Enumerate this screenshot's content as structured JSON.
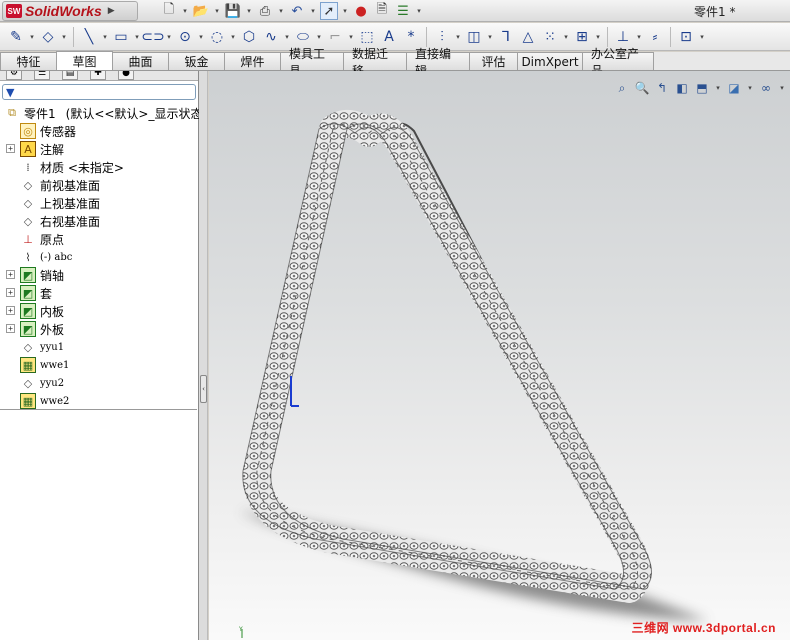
{
  "app": {
    "name": "SolidWorks",
    "logo_mark": "SW",
    "document_title": "零件1 *"
  },
  "tabs": [
    "特征",
    "草图",
    "曲面",
    "钣金",
    "焊件",
    "模具工具",
    "数据迁移",
    "直接编辑",
    "评估",
    "DimXpert",
    "办公室产品"
  ],
  "active_tab": "草图",
  "feature_tree": {
    "filter_icon": "filter-icon",
    "root": {
      "label": "零件1",
      "state": "(默认<<默认>_显示状态"
    },
    "items": [
      {
        "label": "传感器",
        "icon": "sensor-icon",
        "expand": false
      },
      {
        "label": "注解",
        "icon": "annotation-icon",
        "expand": true
      },
      {
        "label": "材质 <未指定>",
        "icon": "material-icon",
        "expand": false
      },
      {
        "label": "前视基准面",
        "icon": "plane-icon",
        "expand": false
      },
      {
        "label": "上视基准面",
        "icon": "plane-icon",
        "expand": false
      },
      {
        "label": "右视基准面",
        "icon": "plane-icon",
        "expand": false
      },
      {
        "label": "原点",
        "icon": "origin-icon",
        "expand": false
      },
      {
        "label": "(-) abc",
        "icon": "sketch-icon",
        "expand": false,
        "small": true
      },
      {
        "label": "销轴",
        "icon": "body-icon",
        "expand": true
      },
      {
        "label": "套",
        "icon": "body-icon",
        "expand": true
      },
      {
        "label": "内板",
        "icon": "body-icon",
        "expand": true
      },
      {
        "label": "外板",
        "icon": "body-icon",
        "expand": true
      },
      {
        "label": "yyu1",
        "icon": "plane-icon",
        "expand": false,
        "small": true
      },
      {
        "label": "wwe1",
        "icon": "pattern-icon",
        "expand": false,
        "small": true
      },
      {
        "label": "yyu2",
        "icon": "plane-icon",
        "expand": false,
        "small": true
      },
      {
        "label": "wwe2",
        "icon": "pattern-icon",
        "expand": false,
        "small": true
      }
    ]
  },
  "viewport": {
    "model": "triangular roller chain",
    "watermark": "三维网 www.3dportal.cn",
    "triad_axis": "Y"
  }
}
